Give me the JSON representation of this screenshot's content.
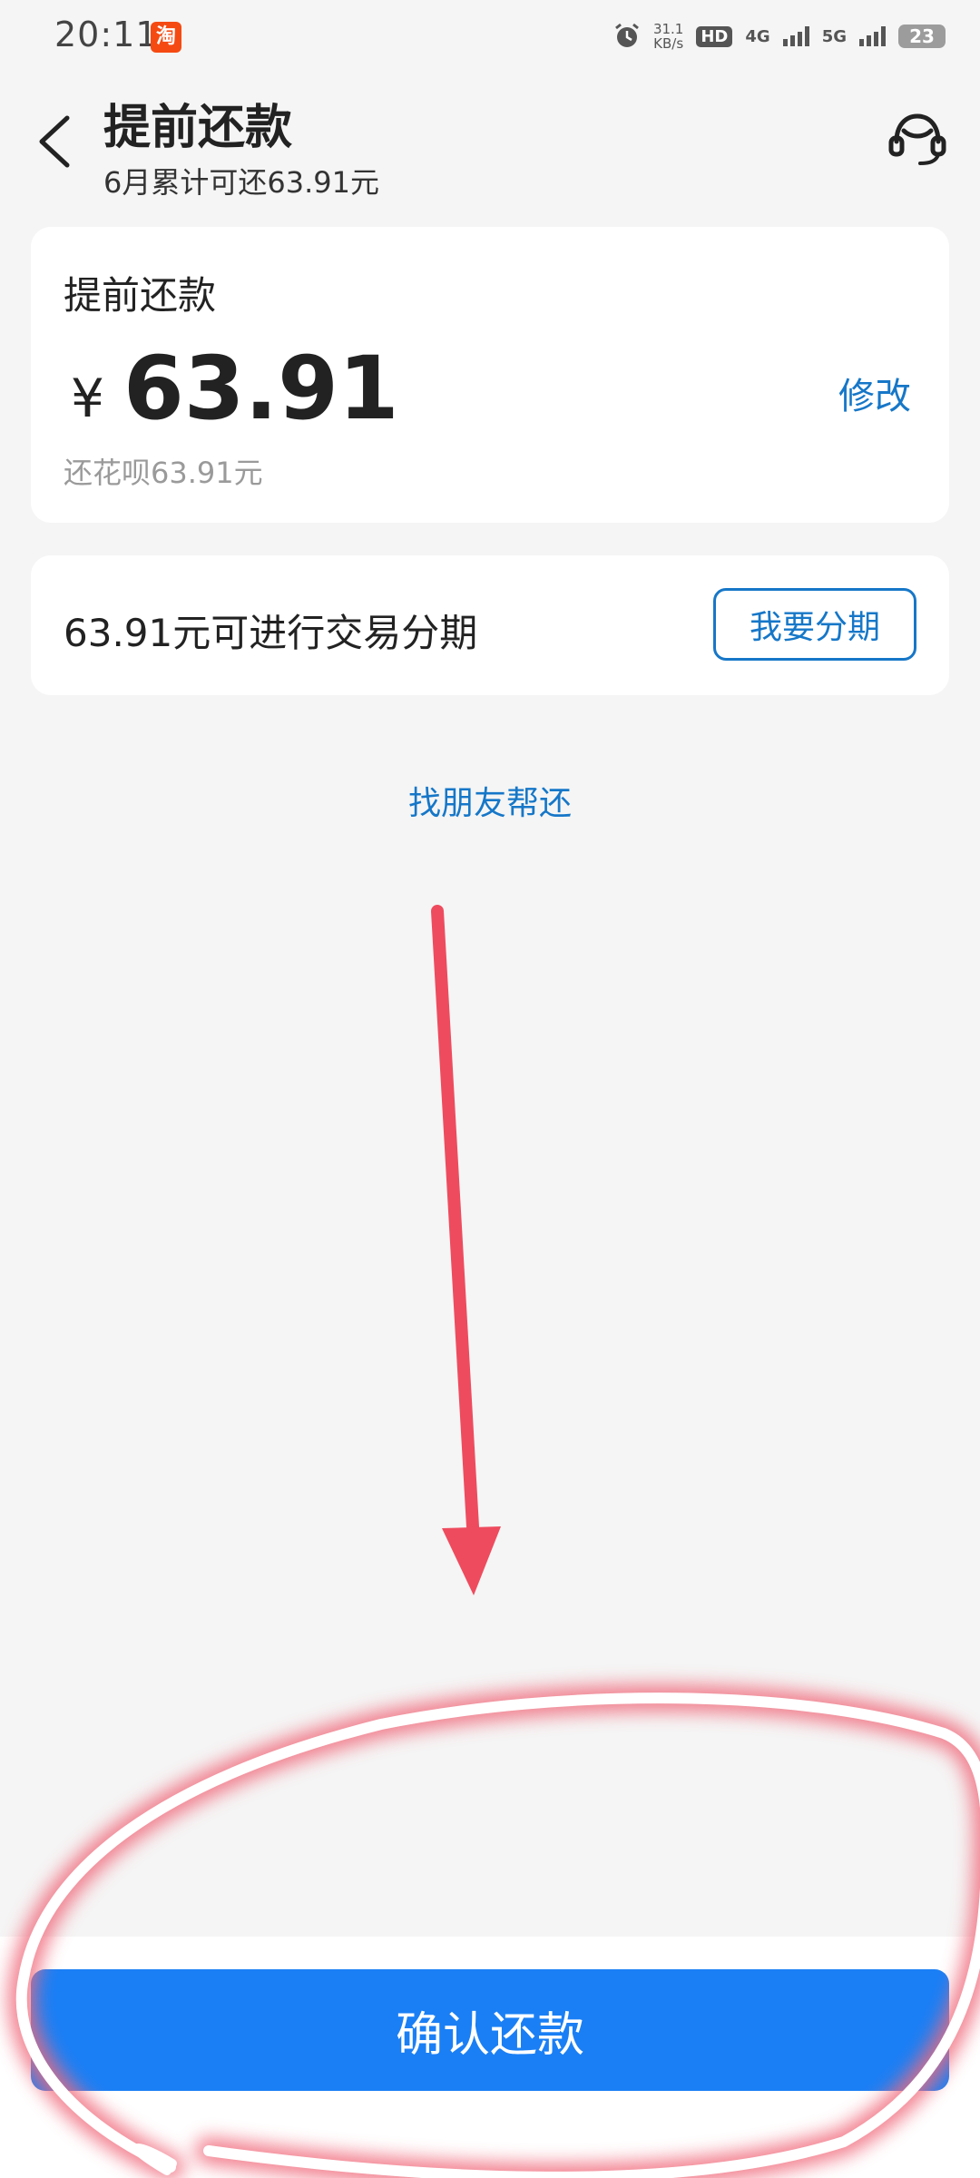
{
  "status_bar": {
    "time": "20:11",
    "app_icon": "淘",
    "net_speed_value": "31.1",
    "net_speed_unit": "KB/s",
    "hd_badge": "HD",
    "signal_1": "4G",
    "signal_2": "5G",
    "battery": "23"
  },
  "header": {
    "title": "提前还款",
    "subtitle": "6月累计可还63.91元"
  },
  "amount_card": {
    "title": "提前还款",
    "currency": "¥",
    "amount": "63.91",
    "modify_label": "修改",
    "note": "还花呗63.91元"
  },
  "installment_card": {
    "text": "63.91元可进行交易分期",
    "button_label": "我要分期"
  },
  "friend_link": "找朋友帮还",
  "confirm_button": "确认还款",
  "colors": {
    "accent_blue": "#1677c8",
    "button_blue": "#1a7ff5",
    "annotation_red": "#ee4b5e"
  },
  "icons": {
    "back": "chevron-left-icon",
    "service": "headset-icon",
    "alarm": "alarm-icon",
    "app": "taobao-icon"
  }
}
